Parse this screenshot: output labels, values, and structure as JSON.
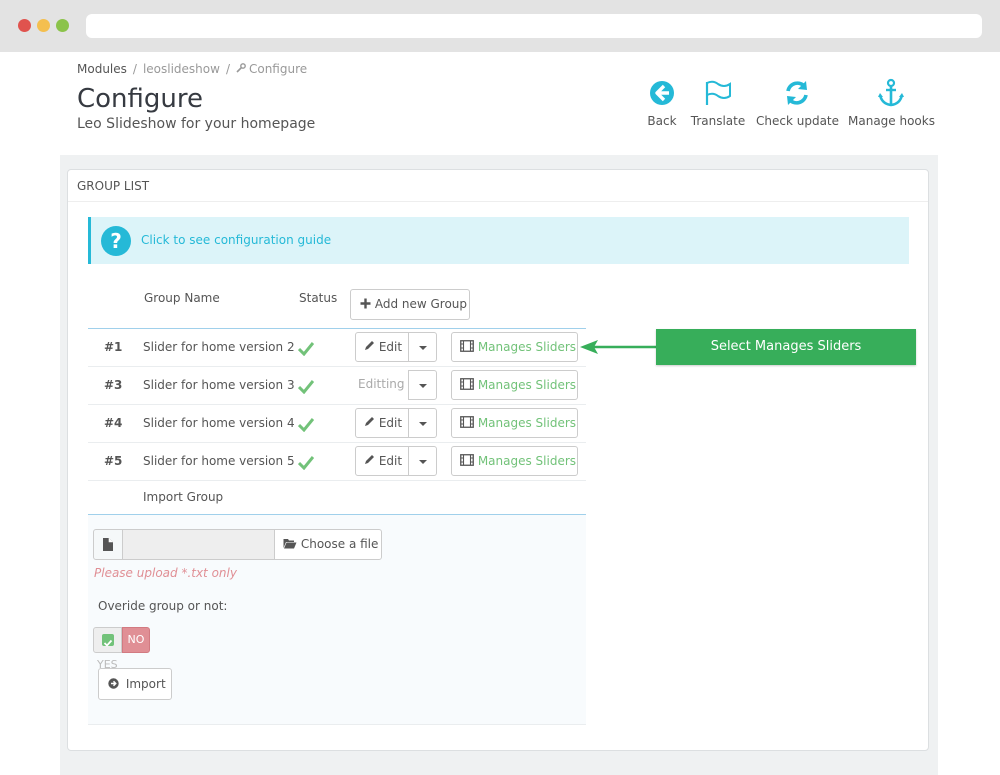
{
  "breadcrumb": {
    "item1": "Modules",
    "item2": "leoslideshow",
    "item3": "Configure",
    "sep": "/"
  },
  "header": {
    "title": "Configure",
    "subtitle": "Leo Slideshow for your homepage"
  },
  "toolbar": {
    "back": "Back",
    "translate": "Translate",
    "check_update": "Check update",
    "manage_hooks": "Manage hooks",
    "icon_color": "#25b9d7"
  },
  "panel": {
    "heading": "Group List"
  },
  "alert": {
    "link_text": "Click to see configuration guide",
    "icon": "question-icon"
  },
  "table": {
    "headers": {
      "group_name": "Group Name",
      "status": "Status"
    },
    "add_button": "Add new Group",
    "rows": [
      {
        "id": "#1",
        "name": "Slider for home version 2",
        "action": "Edit",
        "manage": "Manages Sliders"
      },
      {
        "id": "#3",
        "name": "Slider for home version 3",
        "action": "Editting",
        "manage": "Manages Sliders"
      },
      {
        "id": "#4",
        "name": "Slider for home version 4",
        "action": "Edit",
        "manage": "Manages Sliders"
      },
      {
        "id": "#5",
        "name": "Slider for home version 5",
        "action": "Edit",
        "manage": "Manages Sliders"
      }
    ]
  },
  "import": {
    "label": "Import Group",
    "choose_file": "Choose a file",
    "hint": "Please upload *.txt only",
    "override_label": "Overide group or not:",
    "toggle_no": "NO",
    "toggle_yes": "YES",
    "import_button": "Import"
  },
  "callout": {
    "text": "Select Manages Sliders",
    "color": "#37ae5a"
  }
}
